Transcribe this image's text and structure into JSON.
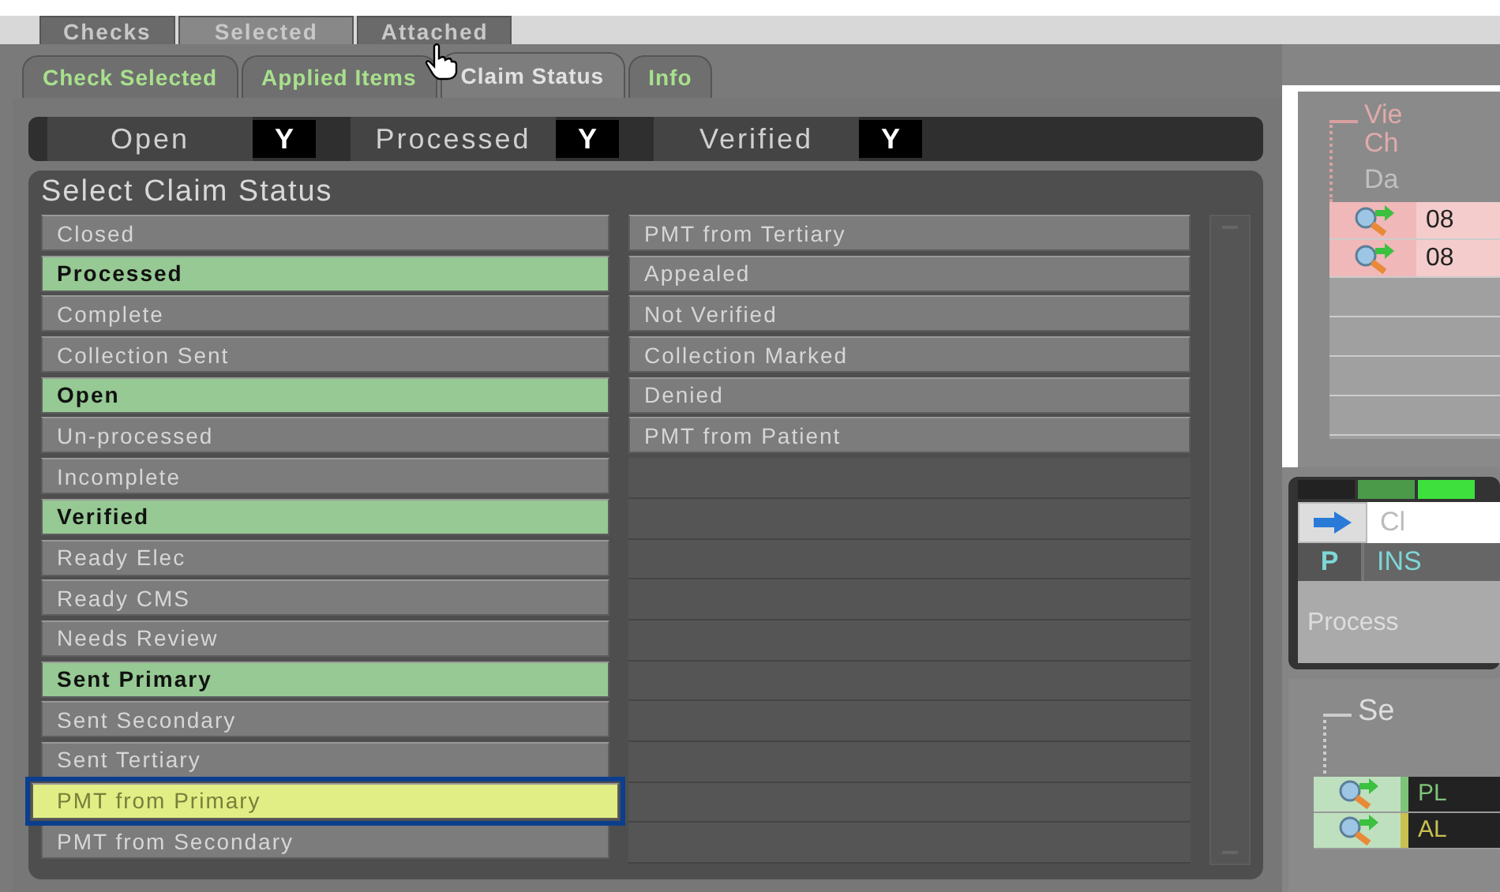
{
  "top_tabs": [
    {
      "label": "Checks",
      "selected": false
    },
    {
      "label": "Selected",
      "selected": true
    },
    {
      "label": "Attached",
      "selected": false
    }
  ],
  "sub_tabs": [
    {
      "label": "Check Selected",
      "selected": false
    },
    {
      "label": "Applied Items",
      "selected": false
    },
    {
      "label": "Claim Status",
      "selected": true
    },
    {
      "label": "Info",
      "selected": false
    }
  ],
  "filters": [
    {
      "label": "Open",
      "value": "Y"
    },
    {
      "label": "Processed",
      "value": "Y"
    },
    {
      "label": "Verified",
      "value": "Y"
    }
  ],
  "status_panel": {
    "title": "Select Claim Status",
    "column_1": [
      {
        "label": "Closed",
        "selected": false,
        "highlighted": false
      },
      {
        "label": "Processed",
        "selected": true,
        "highlighted": false
      },
      {
        "label": "Complete",
        "selected": false,
        "highlighted": false
      },
      {
        "label": "Collection Sent",
        "selected": false,
        "highlighted": false
      },
      {
        "label": "Open",
        "selected": true,
        "highlighted": false
      },
      {
        "label": "Un-processed",
        "selected": false,
        "highlighted": false
      },
      {
        "label": "Incomplete",
        "selected": false,
        "highlighted": false
      },
      {
        "label": "Verified",
        "selected": true,
        "highlighted": false
      },
      {
        "label": "Ready Elec",
        "selected": false,
        "highlighted": false
      },
      {
        "label": "Ready CMS",
        "selected": false,
        "highlighted": false
      },
      {
        "label": "Needs Review",
        "selected": false,
        "highlighted": false
      },
      {
        "label": "Sent Primary",
        "selected": true,
        "highlighted": false
      },
      {
        "label": "Sent Secondary",
        "selected": false,
        "highlighted": false
      },
      {
        "label": "Sent Tertiary",
        "selected": false,
        "highlighted": false
      },
      {
        "label": "PMT from Primary",
        "selected": false,
        "highlighted": true
      },
      {
        "label": "PMT from Secondary",
        "selected": false,
        "highlighted": false
      }
    ],
    "column_2": [
      {
        "label": "PMT from Tertiary",
        "selected": false,
        "highlighted": false
      },
      {
        "label": "Appealed",
        "selected": false,
        "highlighted": false
      },
      {
        "label": "Not Verified",
        "selected": false,
        "highlighted": false
      },
      {
        "label": "Collection Marked",
        "selected": false,
        "highlighted": false
      },
      {
        "label": "Denied",
        "selected": false,
        "highlighted": false
      },
      {
        "label": "PMT from Patient",
        "selected": false,
        "highlighted": false
      }
    ]
  },
  "right_panel": {
    "heading_1": "Vie",
    "heading_2": "Ch",
    "column_header": "Da",
    "rows": [
      {
        "cell": "08"
      },
      {
        "cell": "08"
      }
    ],
    "claim_field": "Cl",
    "code": "P",
    "type": "INS",
    "status": "Process",
    "section_title": "Se",
    "items": [
      {
        "cell": "PL",
        "color": "#7fc47a"
      },
      {
        "cell": "AL",
        "color": "#c8c050"
      }
    ]
  }
}
